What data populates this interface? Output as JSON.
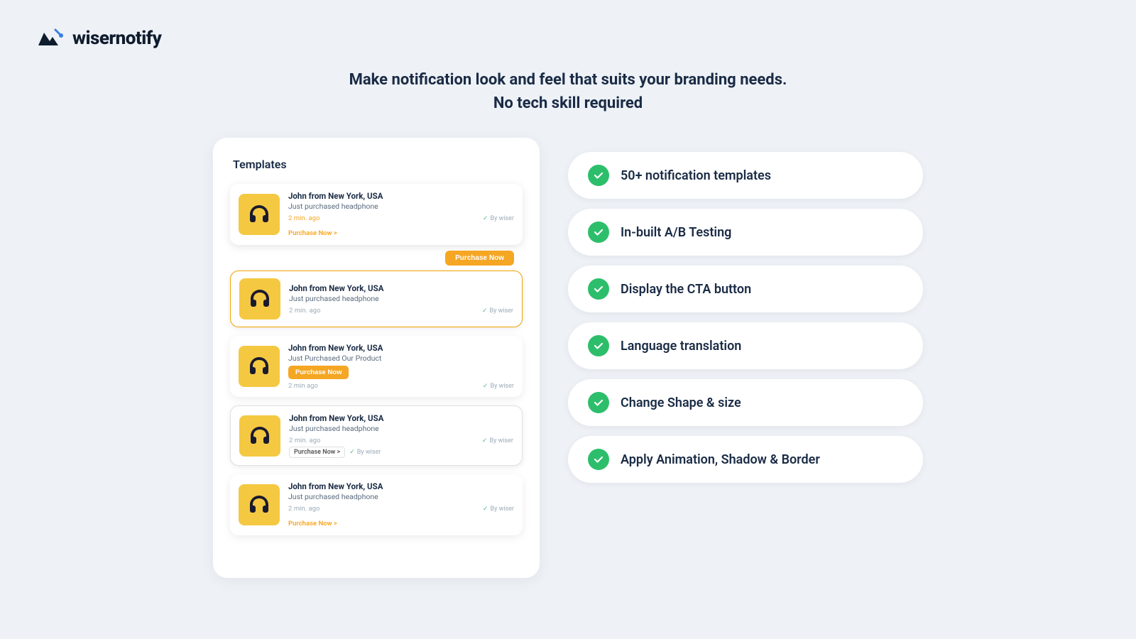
{
  "logo": {
    "text": "wisernotify"
  },
  "hero": {
    "line1": "Make notification look and feel that suits your branding needs.",
    "line2": "No tech skill required"
  },
  "templates": {
    "title": "Templates",
    "cards": [
      {
        "id": "card1",
        "name": "John from New York, USA",
        "desc": "Just purchased headphone",
        "time": "2 min. ago",
        "style": "shadow",
        "cta": "purchase-link",
        "ctaText": "Purchase Now >",
        "byWiser": "By wiser"
      },
      {
        "id": "card2",
        "name": "John from New York, USA",
        "desc": "Just purchased headphone",
        "time": "2 min. ago",
        "style": "outlined-floating-cta",
        "ctaText": "Purchase Now",
        "byWiser": "By wiser"
      },
      {
        "id": "card3",
        "name": "John from New York, USA",
        "desc": "Just Purchased Our Product",
        "time": "2 min ago",
        "style": "inline-cta",
        "ctaText": "Purchase Now",
        "byWiser": "By wiser"
      },
      {
        "id": "card4",
        "name": "John from New York, USA",
        "desc": "Just purchased headphone",
        "time": "2 min. ago",
        "style": "outlined-purchase-link",
        "ctaText": "Purchase Now >",
        "byWiser": "By wiser"
      },
      {
        "id": "card5",
        "name": "John from New York, USA",
        "desc": "Just purchased headphone",
        "time": "2 min. ago",
        "style": "plain",
        "ctaText": "Purchase Now >",
        "byWiser": "By wiser"
      }
    ]
  },
  "features": [
    {
      "id": "f1",
      "label": "50+ notification templates"
    },
    {
      "id": "f2",
      "label": "In-built A/B Testing"
    },
    {
      "id": "f3",
      "label": "Display the CTA button"
    },
    {
      "id": "f4",
      "label": "Language translation"
    },
    {
      "id": "f5",
      "label": "Change Shape & size"
    },
    {
      "id": "f6",
      "label": "Apply Animation, Shadow & Border"
    }
  ]
}
